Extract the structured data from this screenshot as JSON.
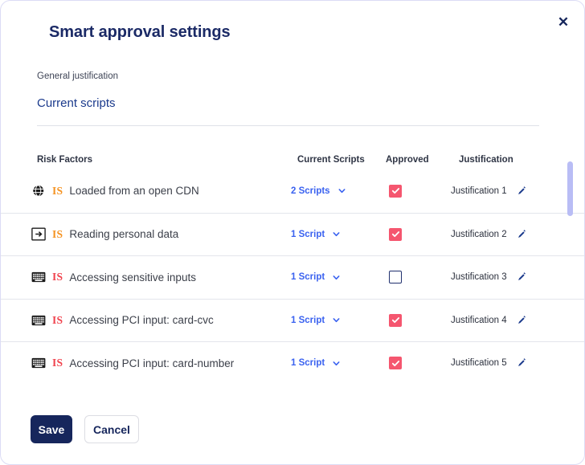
{
  "dialog": {
    "title": "Smart approval settings",
    "close_label": "✕",
    "close_icon": "close-icon"
  },
  "general_justification": {
    "label": "General justification",
    "value": "Current scripts"
  },
  "table": {
    "headers": {
      "risk_factors": "Risk Factors",
      "current_scripts": "Current Scripts",
      "approved": "Approved",
      "justification": "Justification"
    },
    "rows": [
      {
        "icon": "globe-icon",
        "badge": "IS",
        "badge_color": "#f59322",
        "label": "Loaded from an open CDN",
        "scripts": "2 Scripts",
        "scripts_chevron": "chevron-down-icon",
        "approved": true,
        "justification": "Justification 1",
        "edit_icon": "pencil-icon"
      },
      {
        "icon": "login-icon",
        "badge": "IS",
        "badge_color": "#f59322",
        "label": "Reading personal data",
        "scripts": "1 Script",
        "scripts_chevron": "chevron-down-icon",
        "approved": true,
        "justification": "Justification 2",
        "edit_icon": "pencil-icon"
      },
      {
        "icon": "keyboard-icon",
        "badge": "IS",
        "badge_color": "#f0434e",
        "label": "Accessing sensitive inputs",
        "scripts": "1 Script",
        "scripts_chevron": "chevron-down-icon",
        "approved": false,
        "justification": "Justification 3",
        "edit_icon": "pencil-icon"
      },
      {
        "icon": "keyboard-icon",
        "badge": "IS",
        "badge_color": "#f0434e",
        "label": "Accessing PCI input: card-cvc",
        "scripts": "1 Script",
        "scripts_chevron": "chevron-down-icon",
        "approved": true,
        "justification": "Justification 4",
        "edit_icon": "pencil-icon"
      },
      {
        "icon": "keyboard-icon",
        "badge": "IS",
        "badge_color": "#f0434e",
        "label": "Accessing PCI input: card-number",
        "scripts": "1 Script",
        "scripts_chevron": "chevron-down-icon",
        "approved": true,
        "justification": "Justification 5",
        "edit_icon": "pencil-icon"
      }
    ]
  },
  "footer": {
    "save_label": "Save",
    "cancel_label": "Cancel"
  },
  "colors": {
    "title": "#1b2a66",
    "link": "#3a62f0",
    "checkbox_checked": "#f5566f",
    "badge_orange": "#f59322",
    "badge_red": "#f0434e",
    "primary_button": "#16265c",
    "scrollbar_thumb": "#b9bdf5"
  }
}
